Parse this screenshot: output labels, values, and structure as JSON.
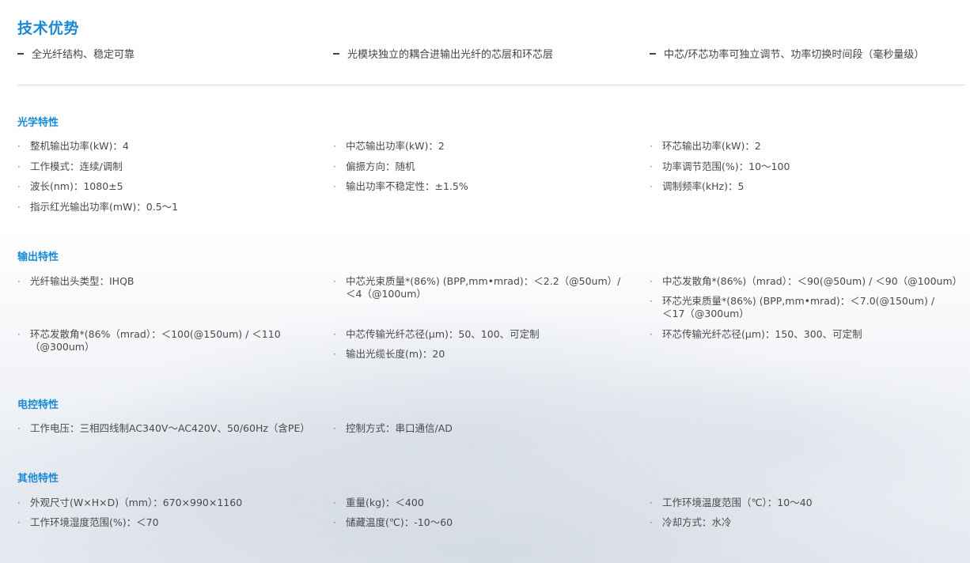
{
  "page_title": "技术优势",
  "advantages": [
    "全光纤结构、稳定可靠",
    "光模块独立的耦合进输出光纤的芯层和环芯层",
    "中芯/环芯功率可独立调节、功率切换时间段（毫秒量级）"
  ],
  "sections": {
    "optical": {
      "title": "光学特性",
      "items": [
        "整机输出功率(kW)：4",
        "中芯输出功率(kW)：2",
        "环芯输出功率(kW)：2",
        "工作模式：连续/调制",
        "偏振方向：随机",
        "功率调节范围(%)：10～100",
        "波长(nm)：1080±5",
        "输出功率不稳定性：±1.5%",
        "调制频率(kHz)：5",
        "指示红光输出功率(mW)：0.5～1"
      ]
    },
    "output": {
      "title": "输出特性",
      "items": [
        "光纤输出头类型：IHQB",
        "中芯光束质量*(86%) (BPP,mm•mrad)：＜2.2（@50um）/ ＜4（@100um）",
        "中芯发散角*(86%)（mrad）：＜90(@50um) / ＜90（@100um）",
        "环芯光束质量*(86%) (BPP,mm•mrad)：＜7.0(@150um) / ＜17（@300um）",
        "环芯发散角*(86%（mrad）：＜100(@150um) / ＜110（@300um）",
        "中芯传输光纤芯径(μm)：50、100、可定制",
        "环芯传输光纤芯径(μm)：150、300、可定制",
        "输出光缆长度(m)：20"
      ]
    },
    "electrical": {
      "title": "电控特性",
      "items": [
        "工作电压：三相四线制AC340V～AC420V、50/60Hz（含PE）",
        "控制方式：串口通信/AD"
      ]
    },
    "other": {
      "title": "其他特性",
      "items": [
        "外观尺寸(W×H×D)（mm）：670×990×1160",
        "重量(kg)：＜400",
        "工作环境温度范围（℃）：10～40",
        "工作环境湿度范围(%)：＜70",
        "储藏温度(℃)：-10～60",
        "冷却方式：水冷"
      ]
    }
  },
  "bullet_char": "·",
  "colors": {
    "accent": "#1a8ad4",
    "text": "#4a4a4a",
    "divider": "#dcdcdc"
  }
}
